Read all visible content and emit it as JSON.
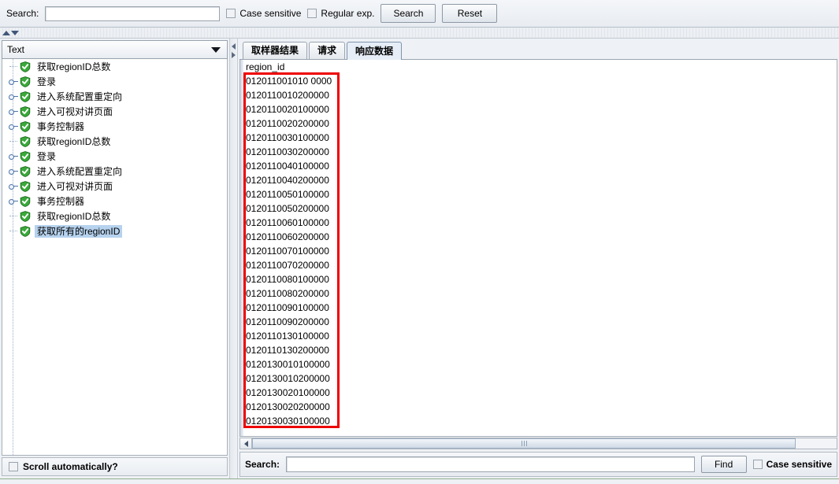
{
  "topbar": {
    "search_label": "Search:",
    "search_value": "",
    "case_sensitive_label": "Case sensitive",
    "regular_exp_label": "Regular exp.",
    "search_button": "Search",
    "reset_button": "Reset"
  },
  "left_panel": {
    "view_selector_value": "Text",
    "scroll_automatically_label": "Scroll automatically?",
    "tree": [
      {
        "label": "获取regionID总数",
        "expandable": false,
        "selected": false
      },
      {
        "label": "登录",
        "expandable": true,
        "selected": false
      },
      {
        "label": "进入系统配置重定向",
        "expandable": true,
        "selected": false
      },
      {
        "label": "进入可视对讲页面",
        "expandable": true,
        "selected": false
      },
      {
        "label": "事务控制器",
        "expandable": true,
        "selected": false
      },
      {
        "label": "获取regionID总数",
        "expandable": false,
        "selected": false
      },
      {
        "label": "登录",
        "expandable": true,
        "selected": false
      },
      {
        "label": "进入系统配置重定向",
        "expandable": true,
        "selected": false
      },
      {
        "label": "进入可视对讲页面",
        "expandable": true,
        "selected": false
      },
      {
        "label": "事务控制器",
        "expandable": true,
        "selected": false
      },
      {
        "label": "获取regionID总数",
        "expandable": false,
        "selected": false
      },
      {
        "label": "获取所有的regionID",
        "expandable": false,
        "selected": true
      }
    ]
  },
  "right_panel": {
    "tabs": [
      {
        "label": "取样器结果",
        "active": false
      },
      {
        "label": "请求",
        "active": false
      },
      {
        "label": "响应数据",
        "active": true
      }
    ],
    "response_header": "region_id",
    "response_rows": [
      "012011001010 0000",
      "0120110010200000",
      "0120110020100000",
      "0120110020200000",
      "0120110030100000",
      "0120110030200000",
      "0120110040100000",
      "0120110040200000",
      "0120110050100000",
      "0120110050200000",
      "0120110060100000",
      "0120110060200000",
      "0120110070100000",
      "0120110070200000",
      "0120110080100000",
      "0120110080200000",
      "0120110090100000",
      "0120110090200000",
      "0120110130100000",
      "0120110130200000",
      "0120130010100000",
      "0120130010200000",
      "0120130020100000",
      "0120130020200000",
      "0120130030100000"
    ],
    "find_label": "Search:",
    "find_value": "",
    "find_button": "Find",
    "case_sensitive_label": "Case sensitive"
  },
  "annotation": {
    "highlight_color": "#ee0000"
  }
}
